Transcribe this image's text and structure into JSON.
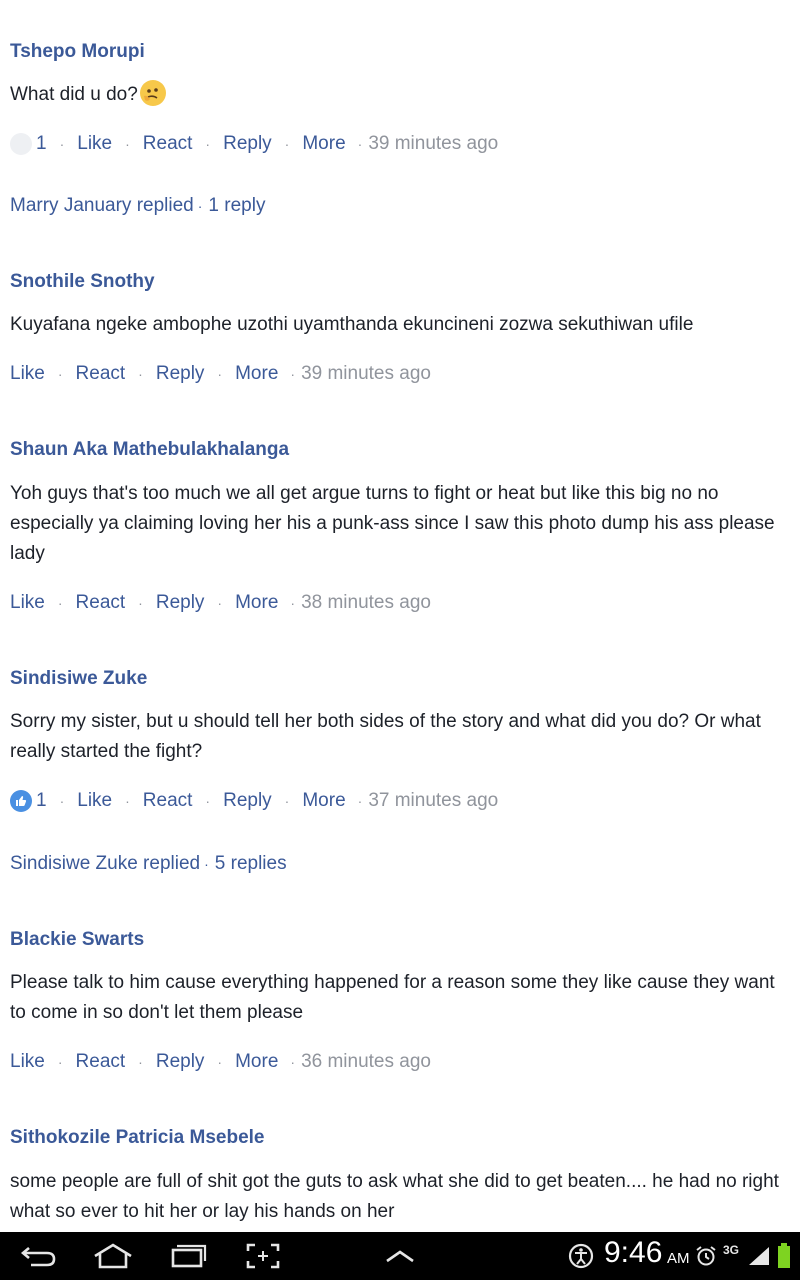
{
  "comments": [
    {
      "name": "Tshepo Morupi",
      "text": "What did u do?",
      "reaction_count": "1",
      "actions": [
        "Like",
        "React",
        "Reply",
        "More"
      ],
      "time": "39 minutes ago",
      "replied": {
        "who": "Marry January replied",
        "count": "1 reply"
      }
    },
    {
      "name": "Snothile Snothy",
      "text": "Kuyafana ngeke ambophe uzothi uyamthanda ekuncineni zozwa sekuthiwan ufile",
      "actions": [
        "Like",
        "React",
        "Reply",
        "More"
      ],
      "time": "39 minutes ago"
    },
    {
      "name": "Shaun Aka Mathebulakhalanga",
      "text": "Yoh guys that's too much we all get argue turns to fight or heat but like this big no no especially ya claiming loving her his a punk-ass since I saw this photo dump his ass please lady",
      "actions": [
        "Like",
        "React",
        "Reply",
        "More"
      ],
      "time": "38 minutes ago"
    },
    {
      "name": "Sindisiwe Zuke",
      "text": "Sorry my sister, but u should tell her both sides of the story and what did you do? Or what really started the fight?",
      "reaction_count": "1",
      "actions": [
        "Like",
        "React",
        "Reply",
        "More"
      ],
      "time": "37 minutes ago",
      "replied": {
        "who": "Sindisiwe Zuke replied",
        "count": "5 replies"
      }
    },
    {
      "name": "Blackie Swarts",
      "text": "Please talk to him cause everything happened for a reason some they like cause they want to come in so don't let them please",
      "actions": [
        "Like",
        "React",
        "Reply",
        "More"
      ],
      "time": "36 minutes ago"
    },
    {
      "name": "Sithokozile Patricia Msebele",
      "text": "some people are full of shit got the guts to ask what she did to get beaten.... he had no right what so ever to hit her or lay his hands on her"
    }
  ],
  "statusbar": {
    "time": "9:46",
    "ampm": "AM",
    "network": "3G"
  },
  "icons": {
    "back": "back-icon",
    "home": "home-icon",
    "recent": "recent-apps-icon",
    "screenshot": "screenshot-icon",
    "up": "chevron-up-icon",
    "accessibility": "accessibility-icon",
    "alarm": "alarm-icon",
    "signal": "signal-icon",
    "battery": "battery-icon"
  },
  "colors": {
    "link": "#3b5998",
    "meta": "#90949c",
    "battery": "#7ed321"
  }
}
